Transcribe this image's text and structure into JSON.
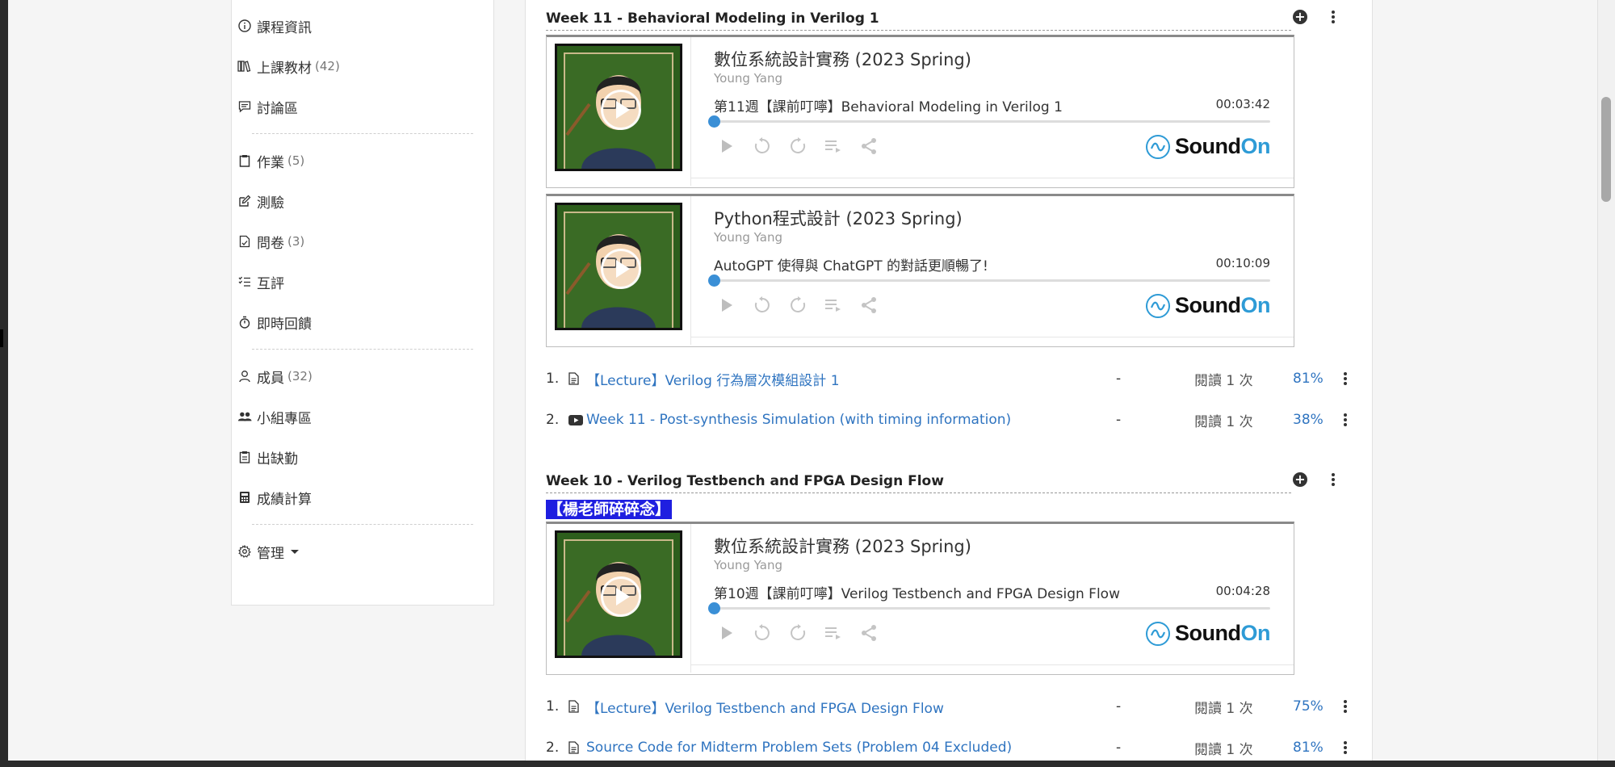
{
  "sidebar": {
    "items": [
      {
        "label": "課程資訊",
        "count": "",
        "icon": "info-icon"
      },
      {
        "label": "上課教材",
        "count": "(42)",
        "icon": "books-icon"
      },
      {
        "label": "討論區",
        "count": "",
        "icon": "comment-icon"
      },
      {
        "label": "作業",
        "count": "(5)",
        "icon": "clipboard-icon"
      },
      {
        "label": "測驗",
        "count": "",
        "icon": "edit-icon"
      },
      {
        "label": "問卷",
        "count": "(3)",
        "icon": "survey-icon"
      },
      {
        "label": "互評",
        "count": "",
        "icon": "list-check-icon"
      },
      {
        "label": "即時回饋",
        "count": "",
        "icon": "stopwatch-icon"
      },
      {
        "label": "成員",
        "count": "(32)",
        "icon": "user-icon"
      },
      {
        "label": "小組專區",
        "count": "",
        "icon": "users-icon"
      },
      {
        "label": "出缺勤",
        "count": "",
        "icon": "attendance-icon"
      },
      {
        "label": "成績計算",
        "count": "",
        "icon": "calculator-icon"
      },
      {
        "label": "管理",
        "count": "",
        "icon": "gear-icon"
      }
    ]
  },
  "sections": [
    {
      "title": "Week 11 - Behavioral Modeling in Verilog 1",
      "players": [
        {
          "title": "數位系統設計實務 (2023 Spring)",
          "author": "Young Yang",
          "episode": "第11週【課前叮嚀】Behavioral Modeling in Verilog 1",
          "duration": "00:03:42"
        },
        {
          "title": "Python程式設計 (2023 Spring)",
          "author": "Young Yang",
          "episode": "AutoGPT 使得與 ChatGPT 的對話更順暢了!",
          "duration": "00:10:09"
        }
      ],
      "rows": [
        {
          "num": "1.",
          "icon": "document-icon",
          "title": "【Lecture】Verilog 行為層次模組設計 1",
          "dash": "-",
          "reads": "閱讀 1 次",
          "pct": "81%"
        },
        {
          "num": "2.",
          "icon": "youtube-icon",
          "title": "Week 11 - Post-synthesis Simulation (with timing information)",
          "dash": "-",
          "reads": "閱讀 1 次",
          "pct": "38%"
        }
      ]
    },
    {
      "title": "Week 10 - Verilog Testbench and FPGA Design Flow",
      "banner": "【楊老師碎碎念】",
      "players": [
        {
          "title": "數位系統設計實務 (2023 Spring)",
          "author": "Young Yang",
          "episode": "第10週【課前叮嚀】Verilog Testbench and FPGA Design Flow",
          "duration": "00:04:28"
        }
      ],
      "rows": [
        {
          "num": "1.",
          "icon": "document-icon",
          "title": "【Lecture】Verilog Testbench and FPGA Design Flow",
          "dash": "-",
          "reads": "閱讀 1 次",
          "pct": "75%"
        },
        {
          "num": "2.",
          "icon": "document-icon",
          "title": "Source Code for Midterm Problem Sets (Problem 04 Excluded)",
          "dash": "-",
          "reads": "閱讀 1 次",
          "pct": "81%"
        }
      ]
    }
  ],
  "player_brand": {
    "sound": "Sound",
    "on": "On"
  },
  "colors": {
    "link": "#2f74c0",
    "accent": "#2e9bd6",
    "banner": "#1f1fe0"
  }
}
